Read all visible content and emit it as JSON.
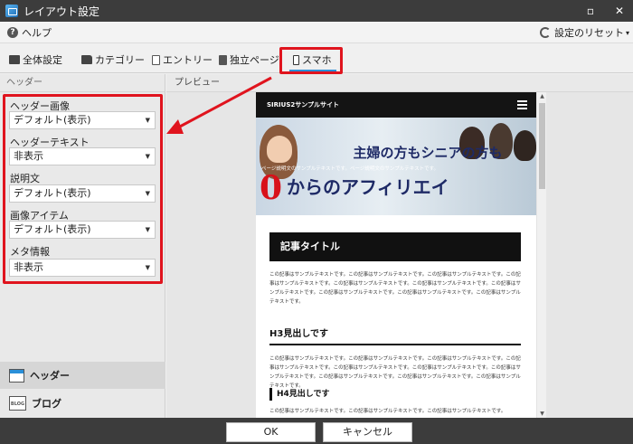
{
  "window": {
    "title": "レイアウト設定",
    "minimize": "▫",
    "close": "✕"
  },
  "menubar": {
    "help_icon": "?",
    "help_label": "ヘルプ",
    "reset_label": "設定のリセット",
    "reset_caret": "▾"
  },
  "tabs": [
    {
      "icon": "monitor-icon",
      "label": "全体設定"
    },
    {
      "icon": "folder-icon",
      "label": "カテゴリー"
    },
    {
      "icon": "document-icon",
      "label": "エントリー"
    },
    {
      "icon": "page-icon",
      "label": "独立ページ"
    },
    {
      "icon": "smartphone-icon",
      "label": "スマホ",
      "selected": true
    }
  ],
  "sidebar": {
    "section_title": "ヘッダー",
    "fields": [
      {
        "label": "ヘッダー画像",
        "value": "デフォルト(表示)"
      },
      {
        "label": "ヘッダーテキスト",
        "value": "非表示"
      },
      {
        "label": "説明文",
        "value": "デフォルト(表示)"
      },
      {
        "label": "画像アイテム",
        "value": "デフォルト(表示)"
      },
      {
        "label": "メタ情報",
        "value": "非表示"
      }
    ],
    "caret": "▼",
    "nav": [
      {
        "icon": "header-layout-icon",
        "label": "ヘッダー",
        "active": true
      },
      {
        "icon": "blog-icon",
        "icon_text": "BLOG",
        "label": "ブログ",
        "active": false
      }
    ]
  },
  "preview": {
    "title": "プレビュー",
    "site_name": "SIRIUS2サンプルサイト",
    "hero": {
      "line1": "主婦の方もシニアの方も",
      "subtitle": "ページ説明文のサンプルテキストです。ページ説明文のサンプルテキストです。",
      "zero": "0",
      "line2": "からのアフィリエイ"
    },
    "article_title": "記事タイトル",
    "paragraph1": "この記事はサンプルテキストです。この記事はサンプルテキストです。この記事はサンプルテキストです。この記事はサンプルテキストです。この記事はサンプルテキストです。この記事はサンプルテキストです。この記事はサンプルテキストです。この記事はサンプルテキストです。この記事はサンプルテキストです。この記事はサンプルテキストです。",
    "h3": "H3見出しです",
    "paragraph2": "この記事はサンプルテキストです。この記事はサンプルテキストです。この記事はサンプルテキストです。この記事はサンプルテキストです。この記事はサンプルテキストです。この記事はサンプルテキストです。この記事はサンプルテキストです。この記事はサンプルテキストです。この記事はサンプルテキストです。この記事はサンプルテキストです。",
    "h4": "H4見出しです",
    "paragraph3": "この記事はサンプルテキストです。この記事はサンプルテキストです。この記事はサンプルテキストです。",
    "scroll_up": "▲",
    "scroll_down": "▼"
  },
  "buttons": {
    "ok": "OK",
    "cancel": "キャンセル"
  },
  "colors": {
    "highlight": "#e0141e",
    "accent": "#2a8fd8",
    "titlebar": "#3c3c3c"
  }
}
